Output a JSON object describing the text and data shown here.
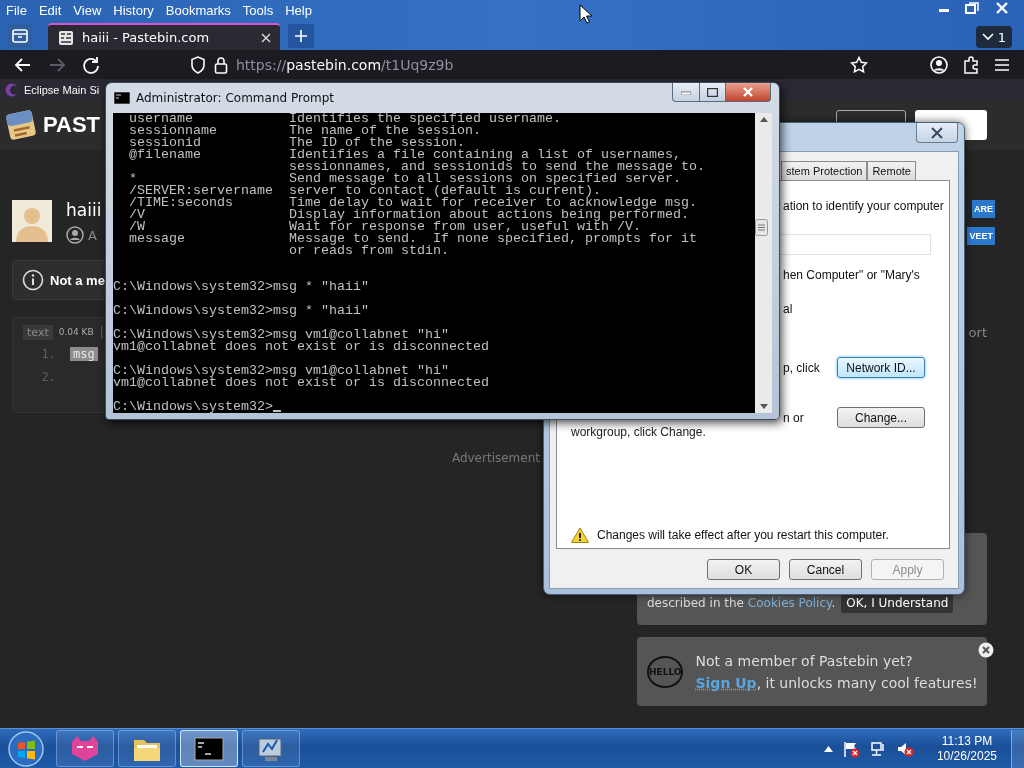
{
  "browser": {
    "menu": [
      "File",
      "Edit",
      "View",
      "History",
      "Bookmarks",
      "Tools",
      "Help"
    ],
    "tab": {
      "title": "haiii - Pastebin.com",
      "selected": true
    },
    "tab_count": "1",
    "nav_buttons": [
      {
        "kind": "back",
        "disabled": false
      },
      {
        "kind": "forward",
        "disabled": true
      },
      {
        "kind": "reload",
        "disabled": false
      }
    ],
    "url": {
      "scheme": "https://",
      "host": "pastebin.com",
      "path": "/t1Uq9z9b"
    },
    "bookmarks": [
      "Eclipse Main Si"
    ]
  },
  "pastebin": {
    "logo": "PAST",
    "paste_title": "haiii",
    "author": "A",
    "notice": "Not a me",
    "syntax": "text",
    "size": "0.04 KB",
    "separator": "|",
    "lines": [
      {
        "number": "1.",
        "code": "msg",
        "highlighted": true
      },
      {
        "number": "2."
      }
    ],
    "share_buttons": [
      "ARE",
      "VEET"
    ],
    "side_link": "ort",
    "ad_label": "Advertisement",
    "cookie": {
      "text": "described in the ",
      "link": "Cookies Policy",
      "end": ".",
      "button": "OK, I Understand"
    },
    "signup": {
      "badge": "HELLO",
      "question": "Not a member of Pastebin yet?",
      "link": "Sign Up",
      "text": ", it unlocks many cool features!"
    }
  },
  "system_properties": {
    "tabs": [
      {
        "label": "stem Protection",
        "selected": false
      },
      {
        "label": "Remote",
        "selected": false
      }
    ],
    "description": "ation to identify your computer",
    "example": "hen Computer\" or \"Mary's",
    "fragment": "al",
    "network_id": {
      "text": "p, click",
      "button": "Network ID...",
      "focused": true
    },
    "change": {
      "text": "n or",
      "continuation": "workgroup, click Change.",
      "button": "Change...",
      "focused": false
    },
    "warning": "Changes will take effect after you restart this computer.",
    "buttons": [
      {
        "label": "OK",
        "disabled": false
      },
      {
        "label": "Cancel",
        "disabled": false
      },
      {
        "label": "Apply",
        "disabled": true
      }
    ]
  },
  "command_prompt": {
    "title": "Administrator: Command Prompt",
    "help": [
      {
        "option": "username",
        "description": "Identifies the specified username."
      },
      {
        "option": "sessionname",
        "description": "The name of the session."
      },
      {
        "option": "sessionid",
        "description": "The ID of the session."
      },
      {
        "option": "@filename",
        "description": "Identifies a file containing a list of usernames,"
      },
      {
        "description": "sessionnames, and sessionids to send the message to."
      },
      {
        "option": "*",
        "description": "Send message to all sessions on specified server."
      },
      {
        "option": "/SERVER:servername",
        "description": "server to contact (default is current)."
      },
      {
        "option": "/TIME:seconds",
        "description": "Time delay to wait for receiver to acknowledge msg."
      },
      {
        "option": "/V",
        "description": "Display information about actions being performed."
      },
      {
        "option": "/W",
        "description": "Wait for response from user, useful with /V."
      },
      {
        "option": "message",
        "description": "Message to send.  If none specified, prompts for it"
      },
      {
        "description": "or reads from stdin."
      }
    ],
    "commands": [
      {
        "input": "C:\\Windows\\system32>msg * \"haii\"",
        "cursor": false
      },
      {
        "input": "C:\\Windows\\system32>msg * \"haii\"",
        "cursor": false
      },
      {
        "input": "C:\\Windows\\system32>msg vm1@collabnet \"hi\"",
        "output": [
          "vm1@collabnet does not exist or is disconnected"
        ],
        "cursor": false
      },
      {
        "input": "C:\\Windows\\system32>msg vm1@collabnet \"hi\"",
        "output": [
          "vm1@collabnet does not exist or is disconnected"
        ],
        "cursor": false
      },
      {
        "input": "C:\\Windows\\system32>",
        "cursor": true
      }
    ]
  },
  "taskbar": {
    "apps": [
      {
        "kind": "cat",
        "selected": false
      },
      {
        "kind": "folder",
        "selected": false
      },
      {
        "kind": "terminal",
        "selected": true
      },
      {
        "kind": "system",
        "selected": false
      }
    ],
    "time": "11:13 PM",
    "date": "10/26/2025"
  }
}
